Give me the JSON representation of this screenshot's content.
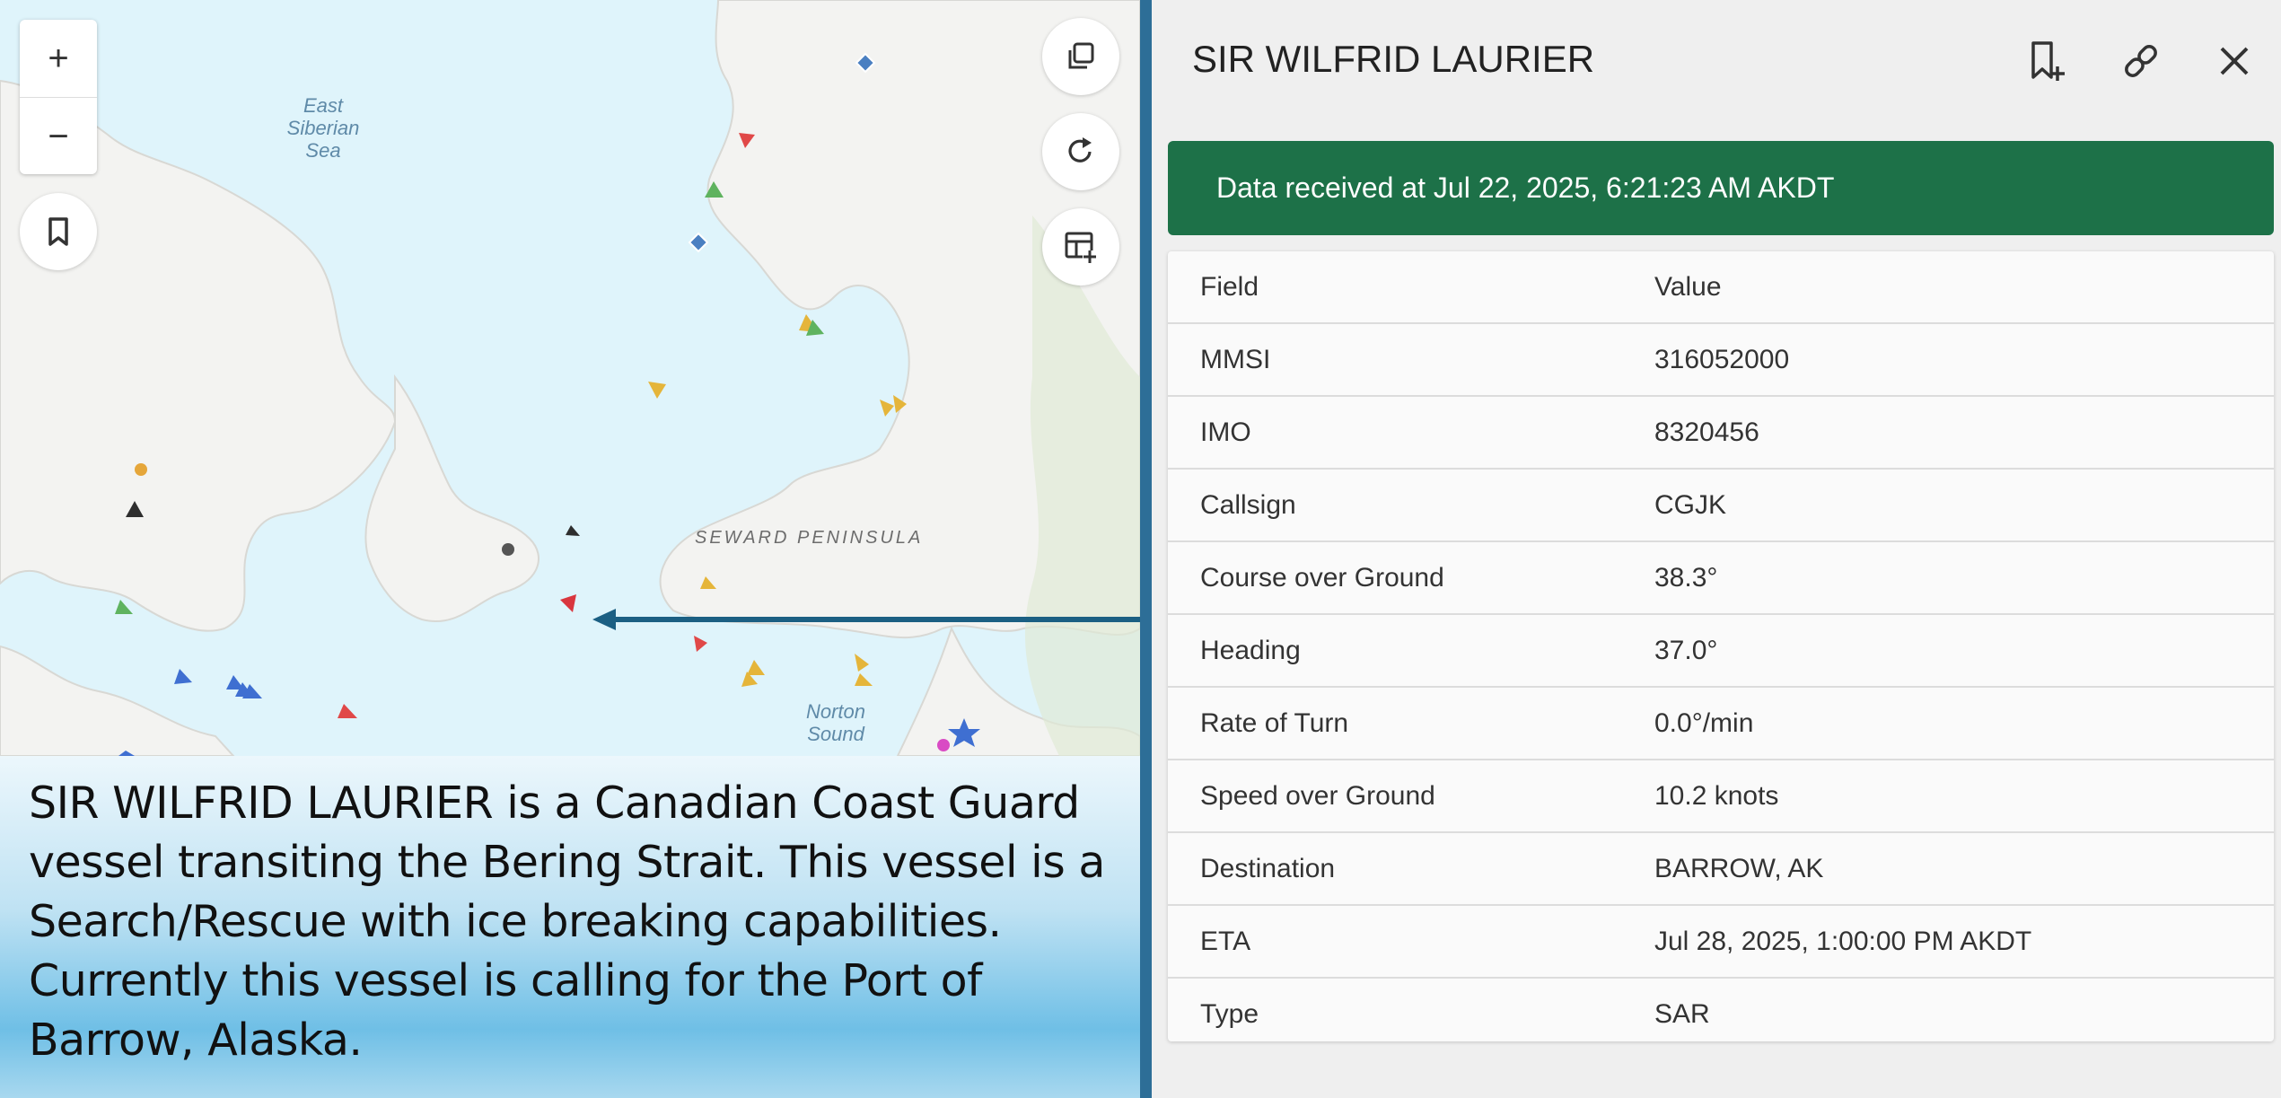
{
  "map": {
    "water_labels": {
      "east_siberian": "East\nSiberian\nSea",
      "norton": "Norton\nSound"
    },
    "land_label": "SEWARD PENINSULA",
    "controls": {
      "zoom_in": "+",
      "zoom_out": "−"
    },
    "icons": [
      "bookmark-icon",
      "copy-icon",
      "refresh-icon",
      "table-add-icon"
    ],
    "colors": {
      "water": "#dff4fb",
      "land": "#f2f2f0",
      "pointer": "#1b5f83"
    }
  },
  "caption": {
    "text": "SIR WILFRID LAURIER is a Canadian Coast Guard vessel transiting the Bering Strait. This vessel is a Search/Rescue with ice breaking capabilities. Currently this vessel is calling for the Port of Barrow, Alaska."
  },
  "panel": {
    "title": "SIR WILFRID LAURIER",
    "icons": [
      "bookmark-add-icon",
      "link-icon",
      "close-icon"
    ],
    "banner": "Data received at Jul 22, 2025, 6:21:23 AM AKDT",
    "banner_color": "#1d7148",
    "table": {
      "header": {
        "field": "Field",
        "value": "Value"
      },
      "rows": [
        {
          "field": "MMSI",
          "value": "316052000"
        },
        {
          "field": "IMO",
          "value": "8320456"
        },
        {
          "field": "Callsign",
          "value": "CGJK"
        },
        {
          "field": "Course over Ground",
          "value": "38.3°"
        },
        {
          "field": "Heading",
          "value": "37.0°"
        },
        {
          "field": "Rate of Turn",
          "value": "0.0°/min"
        },
        {
          "field": "Speed over Ground",
          "value": "10.2 knots"
        },
        {
          "field": "Destination",
          "value": "BARROW, AK"
        },
        {
          "field": "ETA",
          "value": "Jul 28, 2025, 1:00:00 PM AKDT"
        },
        {
          "field": "Type",
          "value": "SAR"
        }
      ]
    }
  }
}
